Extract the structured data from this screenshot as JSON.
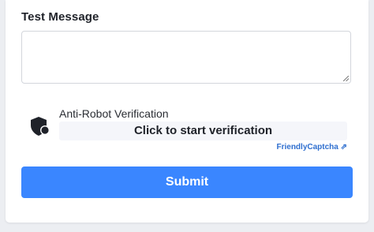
{
  "form": {
    "message_label": "Test Message",
    "message_value": "",
    "submit_label": "Submit"
  },
  "captcha": {
    "title": "Anti-Robot Verification",
    "button_label": "Click to start verification",
    "brand_label": "FriendlyCaptcha ⇗",
    "icon": "shield-icon"
  },
  "colors": {
    "accent": "#3a86ff",
    "link": "#2f6fcf",
    "card": "#ffffff",
    "background": "#eceef2"
  }
}
